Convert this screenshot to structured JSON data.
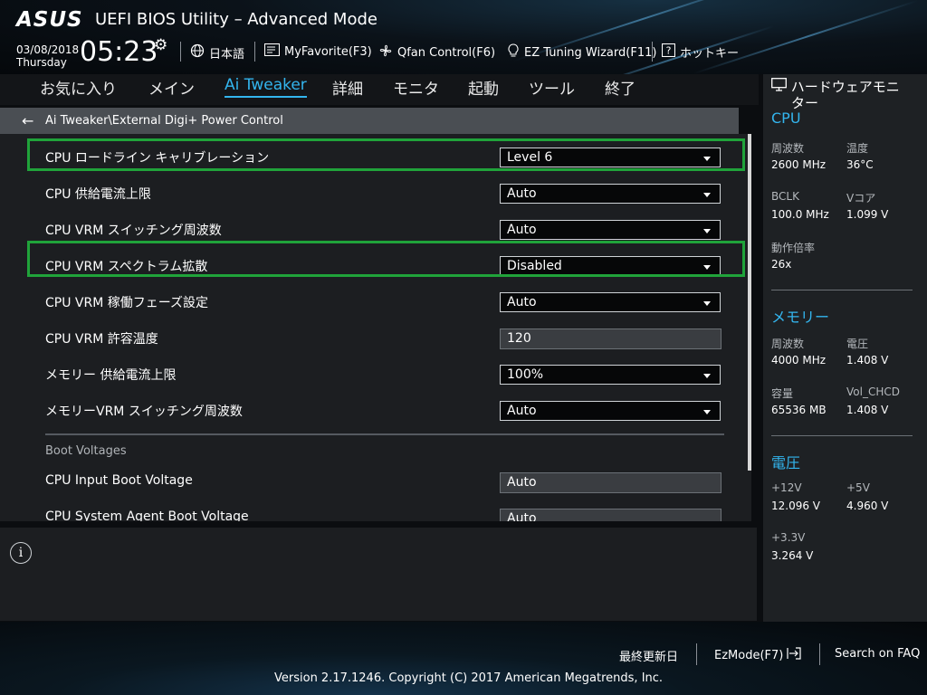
{
  "header": {
    "logo": "ASUS",
    "title": "UEFI BIOS Utility – Advanced Mode",
    "date": "03/08/2018",
    "weekday": "Thursday",
    "time": "05:23",
    "buttons": {
      "language": "日本語",
      "myfavorite": "MyFavorite(F3)",
      "qfan": "Qfan Control(F6)",
      "ez_tuning": "EZ Tuning Wizard(F11)",
      "hotkeys": "ホットキー"
    }
  },
  "tabs": [
    "お気に入り",
    "メイン",
    "Ai Tweaker",
    "詳細",
    "モニタ",
    "起動",
    "ツール",
    "終了"
  ],
  "active_tab": "Ai Tweaker",
  "breadcrumb": "Ai Tweaker\\External Digi+ Power Control",
  "settings": [
    {
      "label": "CPU ロードライン キャリブレーション",
      "value": "Level 6",
      "kind": "select",
      "highlighted": true
    },
    {
      "label": "CPU 供給電流上限",
      "value": "Auto",
      "kind": "select"
    },
    {
      "label": "CPU VRM スイッチング周波数",
      "value": "Auto",
      "kind": "select"
    },
    {
      "label": "CPU VRM スペクトラム拡散",
      "value": "Disabled",
      "kind": "select",
      "highlighted": true
    },
    {
      "label": "CPU VRM 稼働フェーズ設定",
      "value": "Auto",
      "kind": "select"
    },
    {
      "label": "CPU VRM 許容温度",
      "value": "120",
      "kind": "field"
    },
    {
      "label": "メモリー 供給電流上限",
      "value": "100%",
      "kind": "select"
    },
    {
      "label": "メモリーVRM スイッチング周波数",
      "value": "Auto",
      "kind": "select"
    }
  ],
  "boot_section_label": "Boot Voltages",
  "boot_settings": [
    {
      "label": "CPU Input Boot Voltage",
      "value": "Auto"
    },
    {
      "label": "CPU System Agent Boot Voltage",
      "value": "Auto"
    }
  ],
  "hw_monitor": {
    "title_line1": "ハードウェアモニ",
    "title_line2": "ター",
    "cpu": {
      "heading": "CPU",
      "freq_label": "周波数",
      "freq_value": "2600 MHz",
      "temp_label": "温度",
      "temp_value": "36°C",
      "bclk_label": "BCLK",
      "bclk_value": "100.0 MHz",
      "vcore_label": "Vコア",
      "vcore_value": "1.099 V",
      "ratio_label": "動作倍率",
      "ratio_value": "26x"
    },
    "memory": {
      "heading": "メモリー",
      "freq_label": "周波数",
      "freq_value": "4000 MHz",
      "volt_label": "電圧",
      "volt_value": "1.408 V",
      "cap_label": "容量",
      "cap_value": "65536 MB",
      "chcd_label": "Vol_CHCD",
      "chcd_value": "1.408 V"
    },
    "voltage": {
      "heading": "電圧",
      "v12_label": "+12V",
      "v12_value": "12.096 V",
      "v5_label": "+5V",
      "v5_value": "4.960 V",
      "v33_label": "+3.3V",
      "v33_value": "3.264 V"
    }
  },
  "footer": {
    "last_modified": "最終更新日",
    "ezmode": "EzMode(F7)",
    "search": "Search on FAQ",
    "copyright": "Version 2.17.1246. Copyright (C) 2017 American Megatrends, Inc."
  },
  "colors": {
    "accent": "#33b5ee",
    "highlight_border": "#20a33a"
  }
}
